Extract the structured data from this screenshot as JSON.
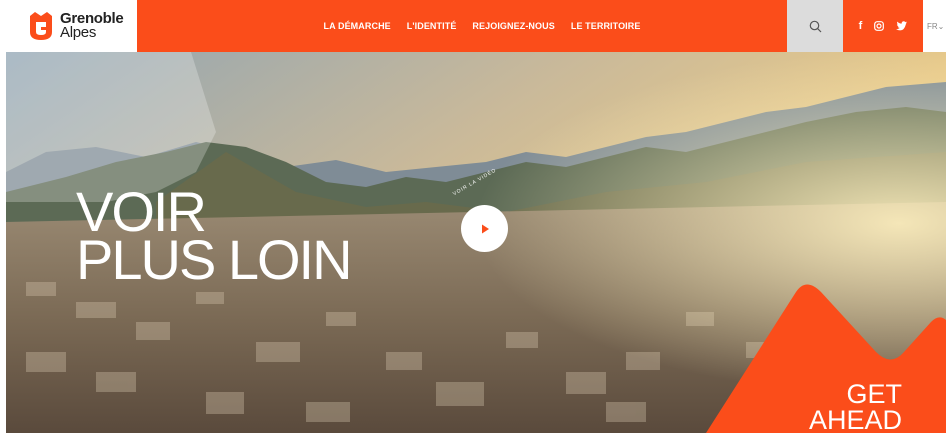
{
  "logo": {
    "line1": "Grenoble",
    "line2": "Alpes"
  },
  "nav": {
    "items": [
      "LA DÉMARCHE",
      "L'IDENTITÉ",
      "REJOIGNEZ-NOUS",
      "LE TERRITOIRE"
    ]
  },
  "search": {
    "icon": "search-icon"
  },
  "social": {
    "icons": [
      "facebook-icon",
      "instagram-icon",
      "twitter-icon"
    ],
    "facebook": "f",
    "instagram": "◎",
    "twitter": "🐦"
  },
  "lang": {
    "current": "FR"
  },
  "hero": {
    "headline_line1": "VOIR",
    "headline_line2": "PLUS LOIN",
    "play_label": "VOIR LA VIDÉO",
    "get_ahead_line1": "GET",
    "get_ahead_line2": "AHEAD"
  },
  "colors": {
    "brand": "#fb4d1a",
    "search_bg": "#dcdcdc"
  }
}
